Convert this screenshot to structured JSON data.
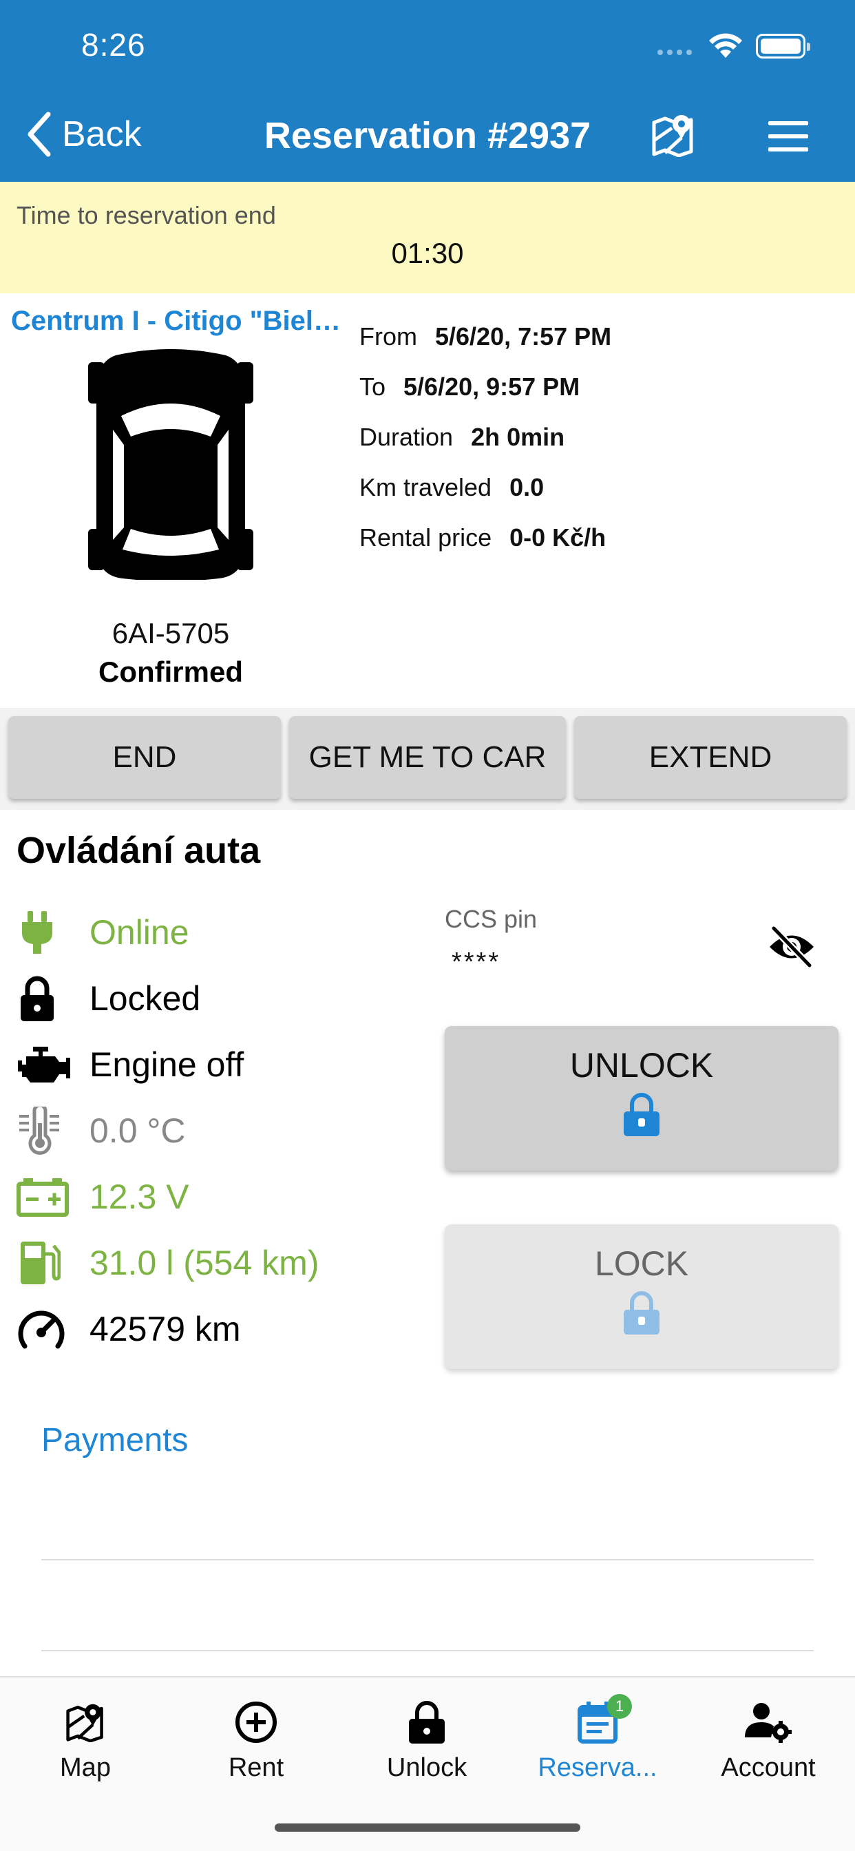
{
  "status_bar": {
    "time": "8:26"
  },
  "nav": {
    "back_label": "Back",
    "title": "Reservation #2937",
    "icons": [
      "map-icon",
      "hamburger-menu-icon"
    ]
  },
  "timer": {
    "label": "Time to reservation end",
    "value": "01:30"
  },
  "car": {
    "name": "Centrum I - Citigo \"Biele...",
    "plate": "6AI-5705",
    "status": "Confirmed"
  },
  "details": [
    {
      "label": "From",
      "value": "5/6/20, 7:57 PM"
    },
    {
      "label": "To",
      "value": "5/6/20, 9:57 PM"
    },
    {
      "label": "Duration",
      "value": "2h 0min"
    },
    {
      "label": "Km traveled",
      "value": "0.0"
    },
    {
      "label": "Rental price",
      "value": "0-0 Kč/h"
    }
  ],
  "actions": {
    "end": "END",
    "get_me": "GET ME TO CAR",
    "extend": "EXTEND"
  },
  "controls": {
    "title": "Ovládání auta",
    "status": [
      {
        "icon": "plug-icon",
        "text": "Online"
      },
      {
        "icon": "lock-icon",
        "text": "Locked"
      },
      {
        "icon": "engine-icon",
        "text": "Engine off"
      },
      {
        "icon": "thermometer-icon",
        "text": "0.0 °C"
      },
      {
        "icon": "battery-icon",
        "text": "12.3 V"
      },
      {
        "icon": "fuel-pump-icon",
        "text": "31.0 l (554 km)"
      },
      {
        "icon": "speedometer-icon",
        "text": "42579 km"
      }
    ],
    "ccs_label": "CCS pin",
    "ccs_value": "****",
    "unlock_label": "UNLOCK",
    "lock_label": "LOCK"
  },
  "payments_label": "Payments",
  "tabs": [
    {
      "label": "Map",
      "icon": "map-icon"
    },
    {
      "label": "Rent",
      "icon": "plus-circle-icon"
    },
    {
      "label": "Unlock",
      "icon": "lock-icon"
    },
    {
      "label": "Reserva...",
      "icon": "calendar-icon",
      "badge": "1",
      "active": true
    },
    {
      "label": "Account",
      "icon": "user-gear-icon"
    }
  ],
  "colors": {
    "header": "#1f7fc4",
    "accent": "#1f86d6",
    "timer_bg": "#fcf9c2",
    "ok_green": "#7cb342"
  }
}
